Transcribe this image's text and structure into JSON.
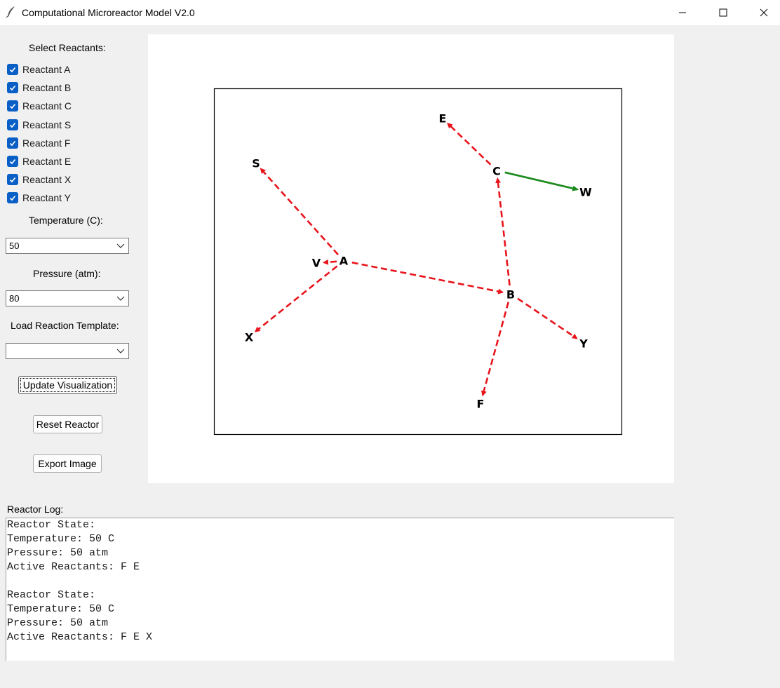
{
  "window": {
    "title": "Computational Microreactor Model V2.0",
    "icon": "feather-icon",
    "controls": [
      "minimize-icon",
      "maximize-icon",
      "close-icon"
    ]
  },
  "sidebar": {
    "reactants_heading": "Select Reactants:",
    "reactants": [
      {
        "label": "Reactant A",
        "checked": true
      },
      {
        "label": "Reactant B",
        "checked": true
      },
      {
        "label": "Reactant C",
        "checked": true
      },
      {
        "label": "Reactant S",
        "checked": true
      },
      {
        "label": "Reactant F",
        "checked": true
      },
      {
        "label": "Reactant E",
        "checked": true
      },
      {
        "label": "Reactant X",
        "checked": true
      },
      {
        "label": "Reactant Y",
        "checked": true
      }
    ],
    "temperature_label": "Temperature (C):",
    "temperature_value": "50",
    "pressure_label": "Pressure (atm):",
    "pressure_value": "80",
    "template_label": "Load Reaction Template:",
    "template_value": "",
    "update_button": "Update Visualization",
    "reset_button": "Reset Reactor",
    "export_button": "Export Image"
  },
  "graph": {
    "colors": {
      "dashed": "#e8141c",
      "solid": "#1a8a1a"
    },
    "nodes": [
      {
        "id": "A",
        "label": "A"
      },
      {
        "id": "B",
        "label": "B"
      },
      {
        "id": "C",
        "label": "C"
      },
      {
        "id": "E",
        "label": "E"
      },
      {
        "id": "W",
        "label": "W"
      },
      {
        "id": "S",
        "label": "S"
      },
      {
        "id": "V",
        "label": "V"
      },
      {
        "id": "X",
        "label": "X"
      },
      {
        "id": "Y",
        "label": "Y"
      },
      {
        "id": "F",
        "label": "F"
      }
    ],
    "edges": [
      {
        "from": "A",
        "to": "S",
        "style": "dashed"
      },
      {
        "from": "A",
        "to": "V",
        "style": "dashed"
      },
      {
        "from": "A",
        "to": "X",
        "style": "dashed"
      },
      {
        "from": "A",
        "to": "B",
        "style": "dashed"
      },
      {
        "from": "B",
        "to": "C",
        "style": "dashed"
      },
      {
        "from": "B",
        "to": "Y",
        "style": "dashed"
      },
      {
        "from": "B",
        "to": "F",
        "style": "dashed"
      },
      {
        "from": "C",
        "to": "E",
        "style": "dashed"
      },
      {
        "from": "C",
        "to": "W",
        "style": "solid"
      }
    ]
  },
  "log": {
    "label": "Reactor Log:",
    "lines": [
      "Reactor State:",
      "Temperature: 50 C",
      "Pressure: 50 atm",
      "Active Reactants: F E",
      "",
      "Reactor State:",
      "Temperature: 50 C",
      "Pressure: 50 atm",
      "Active Reactants: F E X"
    ]
  }
}
